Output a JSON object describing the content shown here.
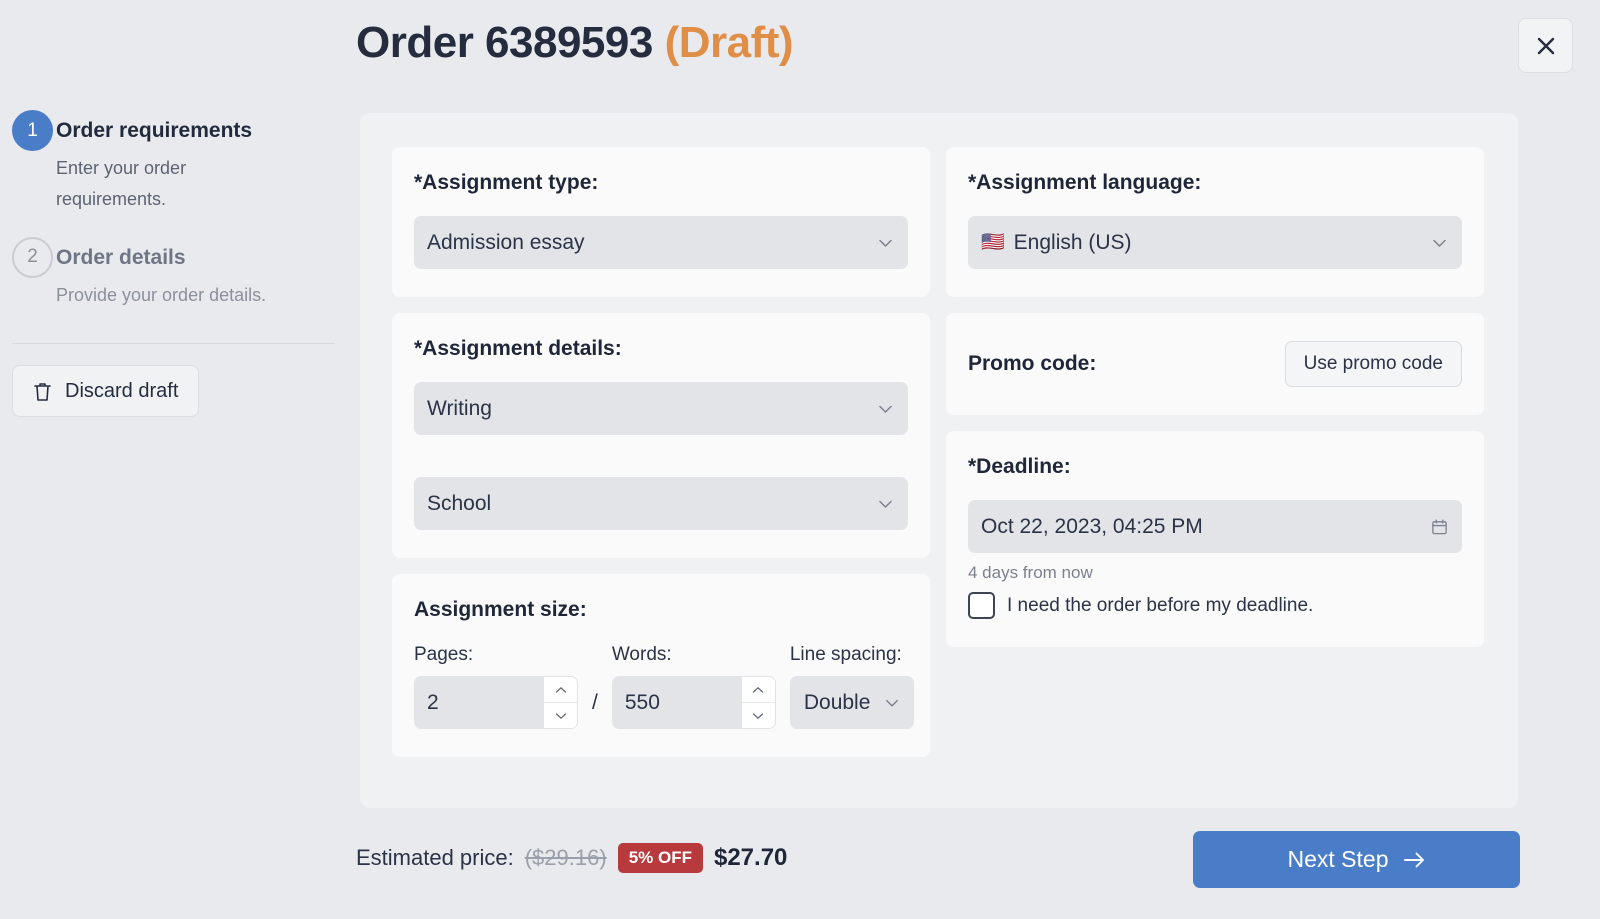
{
  "header": {
    "title_main": "Order 6389593",
    "title_status": "(Draft)",
    "close_label": "✕",
    "draft_color": "#e08e46"
  },
  "sidebar": {
    "steps": [
      {
        "number": "1",
        "title": "Order requirements",
        "desc": "Enter your order requirements.",
        "state": "active"
      },
      {
        "number": "2",
        "title": "Order details",
        "desc": "Provide your order details.",
        "state": "inactive"
      }
    ],
    "discard_label": "Discard draft"
  },
  "form": {
    "assignment_type": {
      "label": "*Assignment type:",
      "value": "Admission essay"
    },
    "assignment_details": {
      "label": "*Assignment details:",
      "value_1": "Writing",
      "value_2": "School"
    },
    "assignment_size": {
      "label": "Assignment size:",
      "pages_label": "Pages:",
      "pages_value": "2",
      "separator": "/",
      "words_label": "Words:",
      "words_value": "550",
      "spacing_label": "Line spacing:",
      "spacing_value": "Double"
    },
    "assignment_language": {
      "label": "*Assignment language:",
      "value": "English (US)",
      "flag": "🇺🇸"
    },
    "promo": {
      "label": "Promo code:",
      "button_label": "Use promo code"
    },
    "deadline": {
      "label": "*Deadline:",
      "value": "Oct 22, 2023, 04:25 PM",
      "hint": "4 days from now",
      "checkbox_label": "I need the order before my deadline.",
      "checked": false
    }
  },
  "footer": {
    "price_label": "Estimated price:",
    "price_old": "($29.16)",
    "discount_badge": "5% OFF",
    "price_new": "$27.70",
    "next_label": "Next Step",
    "accent_color": "#4a7dc8",
    "badge_color": "#b93a3d"
  }
}
